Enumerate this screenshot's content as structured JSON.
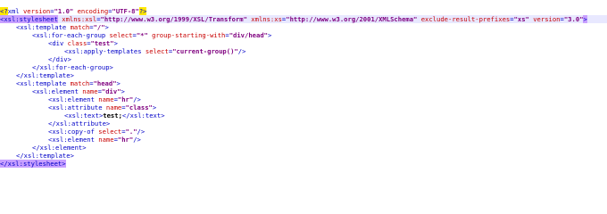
{
  "lines": [
    {
      "indent": 0,
      "current": false,
      "tokens": [
        {
          "t": "<?",
          "c": "t-tag",
          "hl": "hl-yellow"
        },
        {
          "t": "xml ",
          "c": "t-tag"
        },
        {
          "t": "version",
          "c": "t-attr"
        },
        {
          "t": "=",
          "c": "t-tag"
        },
        {
          "t": "\"1.0\" ",
          "c": "t-val"
        },
        {
          "t": "encoding",
          "c": "t-attr"
        },
        {
          "t": "=",
          "c": "t-tag"
        },
        {
          "t": "\"UTF-8\"",
          "c": "t-val"
        },
        {
          "t": "?>",
          "c": "t-tag",
          "hl": "hl-yellow"
        }
      ]
    },
    {
      "indent": 0,
      "current": true,
      "tokens": [
        {
          "t": "<xsl:stylesheet",
          "c": "t-tag",
          "hl": "hl-purple"
        },
        {
          "t": " xmlns:xsl",
          "c": "t-attr"
        },
        {
          "t": "=",
          "c": "t-tag"
        },
        {
          "t": "\"http://www.w3.org/1999/XSL/Transform\" ",
          "c": "t-val"
        },
        {
          "t": "xmlns:xs",
          "c": "t-attr"
        },
        {
          "t": "=",
          "c": "t-tag"
        },
        {
          "t": "\"http://www.w3.org/2001/XMLSchema\" ",
          "c": "t-val"
        },
        {
          "t": "exclude-result-prefixes",
          "c": "t-attr"
        },
        {
          "t": "=",
          "c": "t-tag"
        },
        {
          "t": "\"xs\" ",
          "c": "t-val"
        },
        {
          "t": "version",
          "c": "t-attr"
        },
        {
          "t": "=",
          "c": "t-tag"
        },
        {
          "t": "\"3.0\"",
          "c": "t-val"
        },
        {
          "t": ">",
          "c": "t-tag",
          "hl": "hl-purple"
        }
      ]
    },
    {
      "indent": 1,
      "current": false,
      "tokens": [
        {
          "t": "<xsl:template ",
          "c": "t-tag"
        },
        {
          "t": "match",
          "c": "t-attr"
        },
        {
          "t": "=",
          "c": "t-tag"
        },
        {
          "t": "\"/\"",
          "c": "t-val"
        },
        {
          "t": ">",
          "c": "t-tag"
        }
      ]
    },
    {
      "indent": 2,
      "current": false,
      "tokens": [
        {
          "t": "<xsl:for-each-group ",
          "c": "t-tag"
        },
        {
          "t": "select",
          "c": "t-attr"
        },
        {
          "t": "=",
          "c": "t-tag"
        },
        {
          "t": "\"*\" ",
          "c": "t-val"
        },
        {
          "t": "group-starting-with",
          "c": "t-attr"
        },
        {
          "t": "=",
          "c": "t-tag"
        },
        {
          "t": "\"div/head\"",
          "c": "t-val"
        },
        {
          "t": ">",
          "c": "t-tag"
        }
      ]
    },
    {
      "indent": 3,
      "current": false,
      "tokens": [
        {
          "t": "<div ",
          "c": "t-tag"
        },
        {
          "t": "class",
          "c": "t-attr"
        },
        {
          "t": "=",
          "c": "t-tag"
        },
        {
          "t": "\"test\"",
          "c": "t-val"
        },
        {
          "t": ">",
          "c": "t-tag"
        }
      ]
    },
    {
      "indent": 4,
      "current": false,
      "tokens": [
        {
          "t": "<xsl:apply-templates ",
          "c": "t-tag"
        },
        {
          "t": "select",
          "c": "t-attr"
        },
        {
          "t": "=",
          "c": "t-tag"
        },
        {
          "t": "\"current-group()\"",
          "c": "t-val"
        },
        {
          "t": "/>",
          "c": "t-tag"
        }
      ]
    },
    {
      "indent": 3,
      "current": false,
      "tokens": [
        {
          "t": "</div>",
          "c": "t-tag"
        }
      ]
    },
    {
      "indent": 2,
      "current": false,
      "tokens": [
        {
          "t": "</xsl:for-each-group>",
          "c": "t-tag"
        }
      ]
    },
    {
      "indent": 1,
      "current": false,
      "tokens": [
        {
          "t": "</xsl:template>",
          "c": "t-tag"
        }
      ]
    },
    {
      "indent": 1,
      "current": false,
      "tokens": [
        {
          "t": "<xsl:template ",
          "c": "t-tag"
        },
        {
          "t": "match",
          "c": "t-attr"
        },
        {
          "t": "=",
          "c": "t-tag"
        },
        {
          "t": "\"head\"",
          "c": "t-val"
        },
        {
          "t": ">",
          "c": "t-tag"
        }
      ]
    },
    {
      "indent": 2,
      "current": false,
      "tokens": [
        {
          "t": "<xsl:element ",
          "c": "t-tag"
        },
        {
          "t": "name",
          "c": "t-attr"
        },
        {
          "t": "=",
          "c": "t-tag"
        },
        {
          "t": "\"div\"",
          "c": "t-val"
        },
        {
          "t": ">",
          "c": "t-tag"
        }
      ]
    },
    {
      "indent": 3,
      "current": false,
      "tokens": [
        {
          "t": "<xsl:element ",
          "c": "t-tag"
        },
        {
          "t": "name",
          "c": "t-attr"
        },
        {
          "t": "=",
          "c": "t-tag"
        },
        {
          "t": "\"hr\"",
          "c": "t-val"
        },
        {
          "t": "/>",
          "c": "t-tag"
        }
      ]
    },
    {
      "indent": 3,
      "current": false,
      "tokens": [
        {
          "t": "<xsl:attribute ",
          "c": "t-tag"
        },
        {
          "t": "name",
          "c": "t-attr"
        },
        {
          "t": "=",
          "c": "t-tag"
        },
        {
          "t": "\"class\"",
          "c": "t-val"
        },
        {
          "t": ">",
          "c": "t-tag"
        }
      ]
    },
    {
      "indent": 4,
      "current": false,
      "tokens": [
        {
          "t": "<xsl:text>",
          "c": "t-tag"
        },
        {
          "t": "test;",
          "c": "t-text"
        },
        {
          "t": "</xsl:text>",
          "c": "t-tag"
        }
      ]
    },
    {
      "indent": 3,
      "current": false,
      "tokens": [
        {
          "t": "</xsl:attribute>",
          "c": "t-tag"
        }
      ]
    },
    {
      "indent": 3,
      "current": false,
      "tokens": [
        {
          "t": "<xsl:copy-of ",
          "c": "t-tag"
        },
        {
          "t": "select",
          "c": "t-attr"
        },
        {
          "t": "=",
          "c": "t-tag"
        },
        {
          "t": "\".\"",
          "c": "t-val"
        },
        {
          "t": "/>",
          "c": "t-tag"
        }
      ]
    },
    {
      "indent": 3,
      "current": false,
      "tokens": [
        {
          "t": "<xsl:element ",
          "c": "t-tag"
        },
        {
          "t": "name",
          "c": "t-attr"
        },
        {
          "t": "=",
          "c": "t-tag"
        },
        {
          "t": "\"hr\"",
          "c": "t-val"
        },
        {
          "t": "/>",
          "c": "t-tag"
        }
      ]
    },
    {
      "indent": 2,
      "current": false,
      "tokens": [
        {
          "t": "</xsl:element>",
          "c": "t-tag"
        }
      ]
    },
    {
      "indent": 1,
      "current": false,
      "tokens": [
        {
          "t": "</xsl:template>",
          "c": "t-tag"
        }
      ]
    },
    {
      "indent": 0,
      "current": false,
      "tokens": [
        {
          "t": "</xsl:stylesheet>",
          "c": "t-tag",
          "hl": "hl-purple"
        }
      ]
    }
  ]
}
